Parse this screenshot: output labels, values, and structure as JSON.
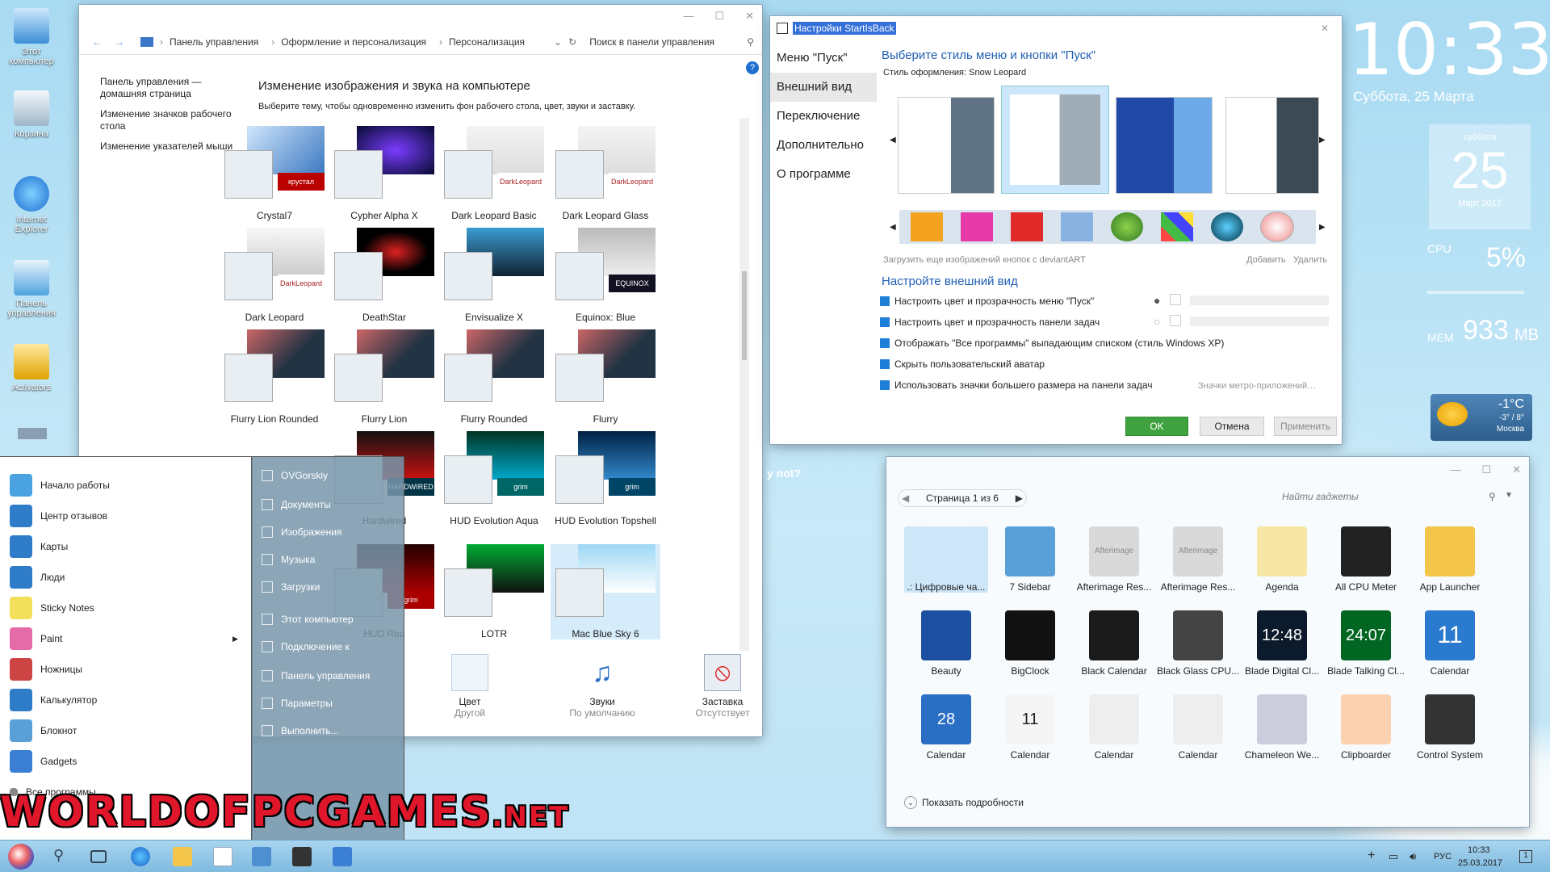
{
  "desktop": {
    "icons": [
      {
        "label": "Этот компьютер"
      },
      {
        "label": "Корзина"
      },
      {
        "label": "Internet Explorer"
      },
      {
        "label": "Панель управления"
      },
      {
        "label": "Activators"
      }
    ],
    "banner_text": "y not?"
  },
  "explorer": {
    "breadcrumbs": [
      "Панель управления",
      "Оформление и персонализация",
      "Персонализация"
    ],
    "search_placeholder": "Поиск в панели управления",
    "nav": [
      "Панель управления — домашняя страница",
      "Изменение значков рабочего стола",
      "Изменение указателей мыши"
    ],
    "heading": "Изменение изображения и звука на компьютере",
    "subheading": "Выберите тему, чтобы одновременно изменить фон рабочего стола, цвет, звуки и заставку.",
    "themes": [
      "Crystal7",
      "Cypher Alpha X",
      "Dark Leopard Basic",
      "Dark Leopard Glass",
      "Dark Leopard",
      "DeathStar",
      "Envisualize X",
      "Equinox: Blue",
      "Flurry Lion Rounded",
      "Flurry Lion",
      "Flurry Rounded",
      "Flurry",
      "Hardwired",
      "HUD Evolution Aqua",
      "HUD Evolution Topshell",
      "HUD Red",
      "LOTR",
      "Mac Blue Sky 6"
    ],
    "badges": {
      "crystal": "крустал",
      "leopard": "DarkLeopard",
      "equinox": "EQUINOX",
      "grim": "grim",
      "hard": "HARDWIRED"
    },
    "bottom": [
      {
        "title": "Цвет",
        "sub": "Другой"
      },
      {
        "title": "Звуки",
        "sub": "По умолчанию"
      },
      {
        "title": "Заставка",
        "sub": "Отсутствует"
      }
    ]
  },
  "startisback": {
    "title": "Настройки StartIsBack",
    "nav": [
      "Меню \"Пуск\"",
      "Внешний вид",
      "Переключение",
      "Дополнительно",
      "О программе"
    ],
    "heading": "Выберите стиль меню и кнопки \"Пуск\"",
    "style_label": "Стиль оформления:",
    "style_value": "Snow Leopard",
    "more_link": "Загрузить еще изображений кнопок с deviantART",
    "add": "Добавить",
    "remove": "Удалить",
    "section2": "Настройте внешний вид",
    "options": [
      "Настроить цвет и прозрачность меню \"Пуск\"",
      "Настроить цвет и прозрачность панели задач",
      "Отображать \"Все программы\" выпадающим списком (стиль Windows XP)",
      "Скрыть пользовательский аватар",
      "Использовать значки большего размера на панели задач"
    ],
    "metro_link": "Значки метро-приложений…",
    "ok": "OK",
    "cancel": "Отмена",
    "apply": "Применить"
  },
  "clock": {
    "time": "10:33",
    "date": "Суббота, 25 Марта"
  },
  "calendar_gadget": {
    "weekday": "суббота",
    "day": "25",
    "month": "Март 2017"
  },
  "meter": {
    "cpu_label": "CPU",
    "cpu_value": "5%",
    "mem_label": "MEM",
    "mem_value": "933",
    "mem_unit": "MB"
  },
  "weather": {
    "temp": "-1°C",
    "range": "-3° / 8°",
    "city": "Москва"
  },
  "start_menu": {
    "left": [
      "Начало работы",
      "Центр отзывов",
      "Карты",
      "Люди",
      "Sticky Notes",
      "Paint",
      "Ножницы",
      "Калькулятор",
      "Блокнот",
      "Gadgets",
      "Все программы"
    ],
    "right": [
      "OVGorskiy",
      "Документы",
      "Изображения",
      "Музыка",
      "Загрузки",
      "Этот компьютер",
      "Подключение к",
      "Панель управления",
      "Параметры",
      "Выполнить..."
    ]
  },
  "gadgets": {
    "page": "Страница 1 из 6",
    "search_placeholder": "Найти гаджеты",
    "items": [
      ".: Цифровые ча...",
      "7 Sidebar",
      "Afterimage Res...",
      "Afterimage Res...",
      "Agenda",
      "All CPU Meter",
      "App Launcher",
      "Beauty",
      "BigClock",
      "Black Calendar",
      "Black Glass CPU...",
      "Blade Digital Cl...",
      "Blade Talking Cl...",
      "Calendar",
      "Calendar",
      "Calendar",
      "Calendar",
      "Calendar",
      "Chameleon We...",
      "Clipboarder",
      "Control System"
    ],
    "details": "Показать подробности",
    "cal_icons": {
      "d28": "28",
      "d11": "11",
      "d11b": "11",
      "dig1": "12:48",
      "dig2": "24:07",
      "afterimage": "Afterimage"
    }
  },
  "watermark": "WORLDOFPCGAMES",
  "watermark_suffix": ".NET",
  "taskbar": {
    "lang": "РУС",
    "time": "10:33",
    "date": "25.03.2017",
    "notif": "1"
  }
}
